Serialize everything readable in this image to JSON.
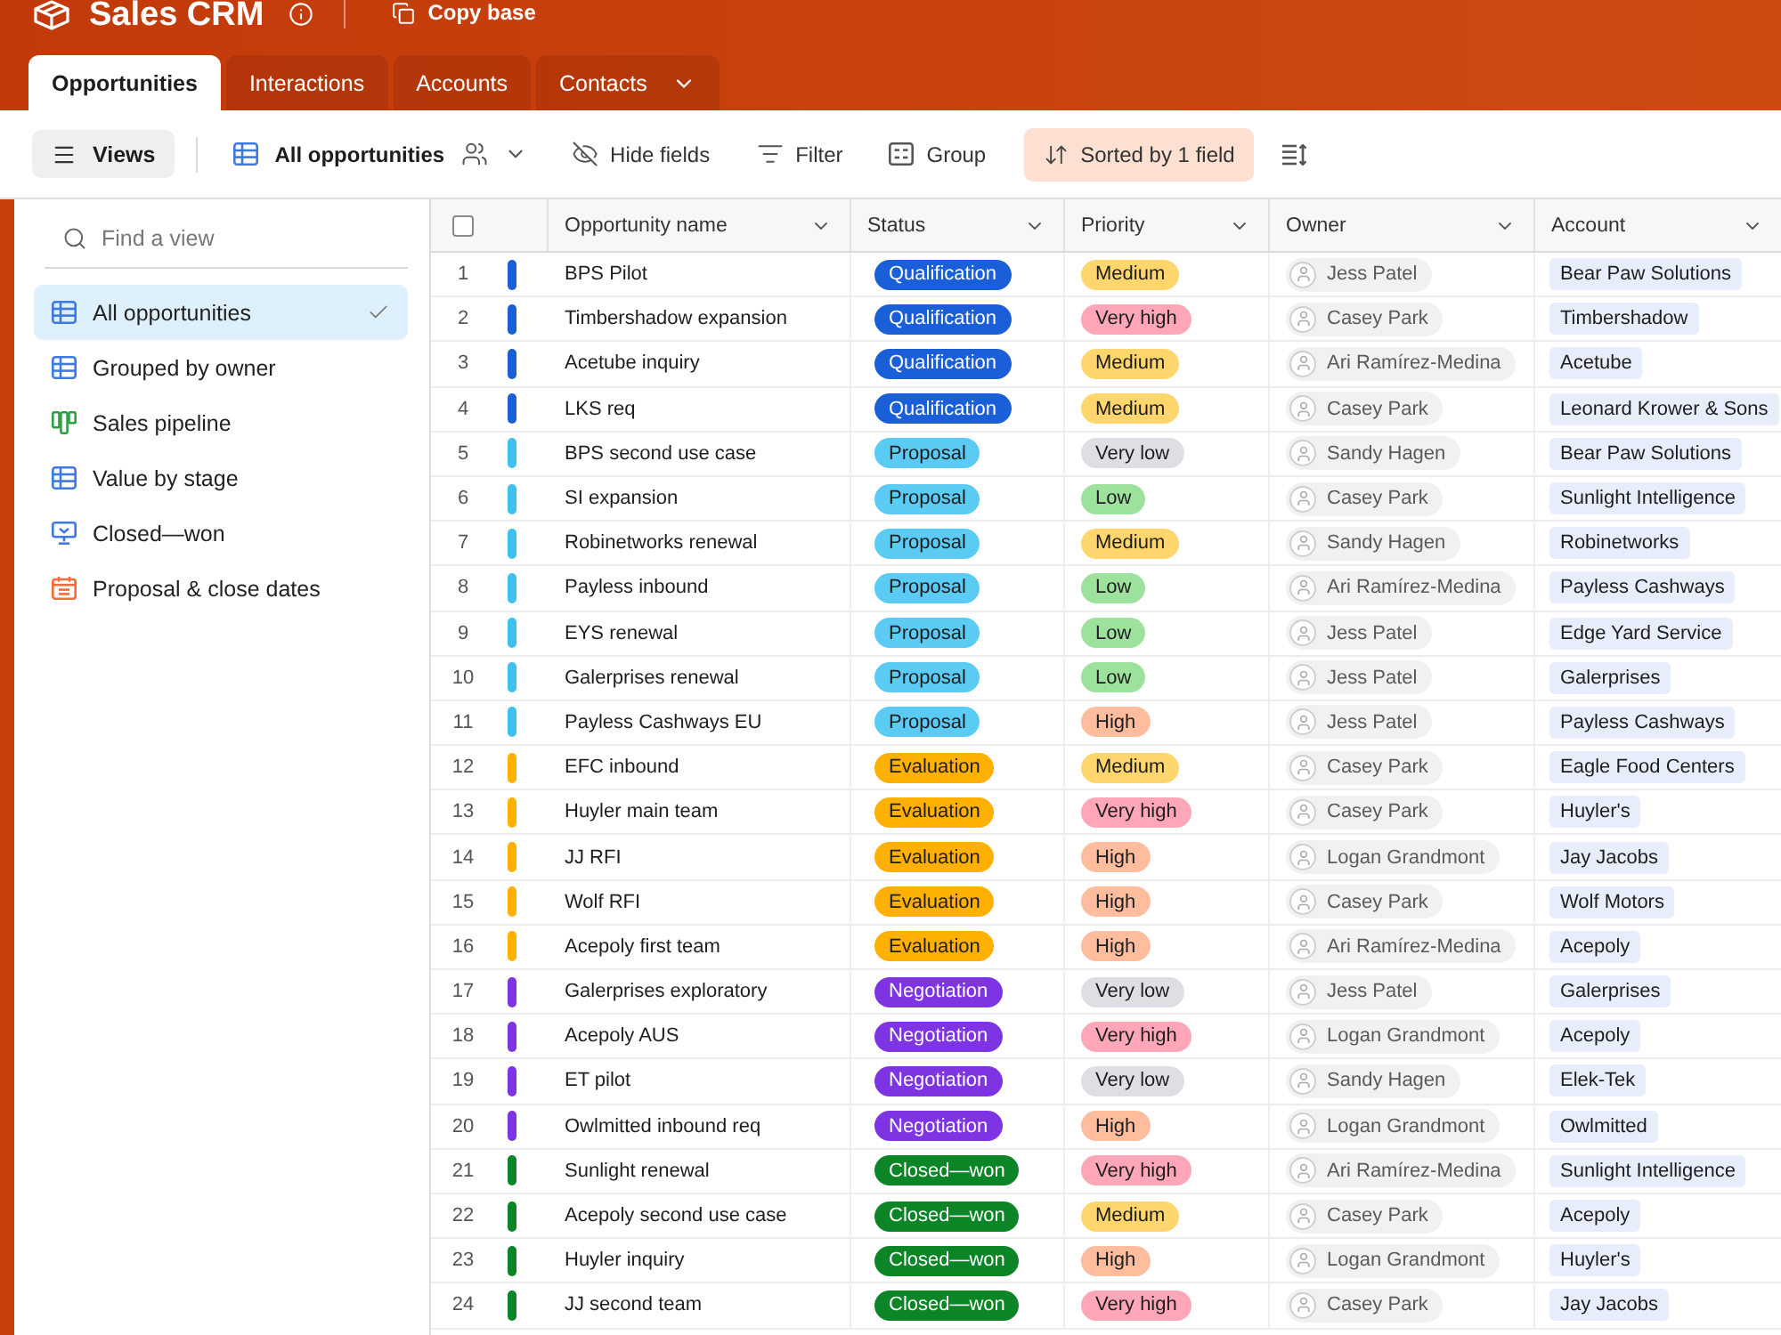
{
  "header": {
    "title": "Sales CRM",
    "copy_button": "Copy base"
  },
  "tabs": [
    {
      "label": "Opportunities",
      "selected": true,
      "dropdown": false
    },
    {
      "label": "Interactions",
      "selected": false,
      "dropdown": false
    },
    {
      "label": "Accounts",
      "selected": false,
      "dropdown": false
    },
    {
      "label": "Contacts",
      "selected": false,
      "dropdown": true
    }
  ],
  "toolbar": {
    "views_button": "Views",
    "current_view": "All opportunities",
    "actions": [
      {
        "kind": "hide",
        "label": "Hide fields",
        "active": false
      },
      {
        "kind": "filter",
        "label": "Filter",
        "active": false
      },
      {
        "kind": "group",
        "label": "Group",
        "active": false
      },
      {
        "kind": "sort",
        "label": "Sorted by 1 field",
        "active": true
      }
    ]
  },
  "sidebar": {
    "search": {
      "placeholder": "Find a view"
    },
    "views": [
      {
        "kind": "grid",
        "label": "All opportunities",
        "selected": true
      },
      {
        "kind": "grid",
        "label": "Grouped by owner",
        "selected": false
      },
      {
        "kind": "kanban",
        "label": "Sales pipeline",
        "selected": false
      },
      {
        "kind": "grid",
        "label": "Value by stage",
        "selected": false
      },
      {
        "kind": "form",
        "label": "Closed—won",
        "selected": false
      },
      {
        "kind": "calendar",
        "label": "Proposal & close dates",
        "selected": false
      }
    ]
  },
  "table": {
    "select_all": {
      "checked": false
    },
    "columns": [
      "Opportunity name",
      "Status",
      "Priority",
      "Owner",
      "Account"
    ],
    "rows": [
      {
        "number": "1",
        "name": "BPS Pilot",
        "color": "#1b5fd8",
        "status": {
          "label": "Qualification",
          "color": "#1b5fd8"
        },
        "priority": {
          "label": "Medium",
          "color": "#ffd66e"
        },
        "owner": "Jess Patel",
        "account": "Bear Paw Solutions"
      },
      {
        "number": "2",
        "name": "Timbershadow expansion",
        "color": "#1b5fd8",
        "status": {
          "label": "Qualification",
          "color": "#1b5fd8"
        },
        "priority": {
          "label": "Very high",
          "color": "#ffa6b8"
        },
        "owner": "Casey Park",
        "account": "Timbershadow"
      },
      {
        "number": "3",
        "name": "Acetube inquiry",
        "color": "#1b5fd8",
        "status": {
          "label": "Qualification",
          "color": "#1b5fd8"
        },
        "priority": {
          "label": "Medium",
          "color": "#ffd66e"
        },
        "owner": "Ari Ramírez-Medina",
        "account": "Acetube"
      },
      {
        "number": "4",
        "name": "LKS req",
        "color": "#1b5fd8",
        "status": {
          "label": "Qualification",
          "color": "#1b5fd8"
        },
        "priority": {
          "label": "Medium",
          "color": "#ffd66e"
        },
        "owner": "Casey Park",
        "account": "Leonard Krower & Sons"
      },
      {
        "number": "5",
        "name": "BPS second use case",
        "color": "#3fc1f0",
        "status": {
          "label": "Proposal",
          "color": "#5ccbf3"
        },
        "priority": {
          "label": "Very low",
          "color": "#dddfe4"
        },
        "owner": "Sandy Hagen",
        "account": "Bear Paw Solutions"
      },
      {
        "number": "6",
        "name": "SI expansion",
        "color": "#3fc1f0",
        "status": {
          "label": "Proposal",
          "color": "#5ccbf3"
        },
        "priority": {
          "label": "Low",
          "color": "#9de29c"
        },
        "owner": "Casey Park",
        "account": "Sunlight Intelligence"
      },
      {
        "number": "7",
        "name": "Robinetworks renewal",
        "color": "#3fc1f0",
        "status": {
          "label": "Proposal",
          "color": "#5ccbf3"
        },
        "priority": {
          "label": "Medium",
          "color": "#ffd66e"
        },
        "owner": "Sandy Hagen",
        "account": "Robinetworks"
      },
      {
        "number": "8",
        "name": "Payless inbound",
        "color": "#3fc1f0",
        "status": {
          "label": "Proposal",
          "color": "#5ccbf3"
        },
        "priority": {
          "label": "Low",
          "color": "#9de29c"
        },
        "owner": "Ari Ramírez-Medina",
        "account": "Payless Cashways"
      },
      {
        "number": "9",
        "name": "EYS renewal",
        "color": "#3fc1f0",
        "status": {
          "label": "Proposal",
          "color": "#5ccbf3"
        },
        "priority": {
          "label": "Low",
          "color": "#9de29c"
        },
        "owner": "Jess Patel",
        "account": "Edge Yard Service"
      },
      {
        "number": "10",
        "name": "Galerprises renewal",
        "color": "#3fc1f0",
        "status": {
          "label": "Proposal",
          "color": "#5ccbf3"
        },
        "priority": {
          "label": "Low",
          "color": "#9de29c"
        },
        "owner": "Jess Patel",
        "account": "Galerprises"
      },
      {
        "number": "11",
        "name": "Payless Cashways EU",
        "color": "#3fc1f0",
        "status": {
          "label": "Proposal",
          "color": "#5ccbf3"
        },
        "priority": {
          "label": "High",
          "color": "#ffbd9e"
        },
        "owner": "Jess Patel",
        "account": "Payless Cashways"
      },
      {
        "number": "12",
        "name": "EFC inbound",
        "color": "#ffb000",
        "status": {
          "label": "Evaluation",
          "color": "#ffb000"
        },
        "priority": {
          "label": "Medium",
          "color": "#ffd66e"
        },
        "owner": "Casey Park",
        "account": "Eagle Food Centers"
      },
      {
        "number": "13",
        "name": "Huyler main team",
        "color": "#ffb000",
        "status": {
          "label": "Evaluation",
          "color": "#ffb000"
        },
        "priority": {
          "label": "Very high",
          "color": "#ffa6b8"
        },
        "owner": "Casey Park",
        "account": "Huyler's"
      },
      {
        "number": "14",
        "name": "JJ RFI",
        "color": "#ffb000",
        "status": {
          "label": "Evaluation",
          "color": "#ffb000"
        },
        "priority": {
          "label": "High",
          "color": "#ffbd9e"
        },
        "owner": "Logan Grandmont",
        "account": "Jay Jacobs"
      },
      {
        "number": "15",
        "name": "Wolf RFI",
        "color": "#ffb000",
        "status": {
          "label": "Evaluation",
          "color": "#ffb000"
        },
        "priority": {
          "label": "High",
          "color": "#ffbd9e"
        },
        "owner": "Casey Park",
        "account": "Wolf Motors"
      },
      {
        "number": "16",
        "name": "Acepoly first team",
        "color": "#ffb000",
        "status": {
          "label": "Evaluation",
          "color": "#ffb000"
        },
        "priority": {
          "label": "High",
          "color": "#ffbd9e"
        },
        "owner": "Ari Ramírez-Medina",
        "account": "Acepoly"
      },
      {
        "number": "17",
        "name": "Galerprises exploratory",
        "color": "#7f34e3",
        "status": {
          "label": "Negotiation",
          "color": "#7f34e3"
        },
        "priority": {
          "label": "Very low",
          "color": "#dddfe4"
        },
        "owner": "Jess Patel",
        "account": "Galerprises"
      },
      {
        "number": "18",
        "name": "Acepoly AUS",
        "color": "#7f34e3",
        "status": {
          "label": "Negotiation",
          "color": "#7f34e3"
        },
        "priority": {
          "label": "Very high",
          "color": "#ffa6b8"
        },
        "owner": "Logan Grandmont",
        "account": "Acepoly"
      },
      {
        "number": "19",
        "name": "ET pilot",
        "color": "#7f34e3",
        "status": {
          "label": "Negotiation",
          "color": "#7f34e3"
        },
        "priority": {
          "label": "Very low",
          "color": "#dddfe4"
        },
        "owner": "Sandy Hagen",
        "account": "Elek-Tek"
      },
      {
        "number": "20",
        "name": "Owlmitted inbound req",
        "color": "#7f34e3",
        "status": {
          "label": "Negotiation",
          "color": "#7f34e3"
        },
        "priority": {
          "label": "High",
          "color": "#ffbd9e"
        },
        "owner": "Logan Grandmont",
        "account": "Owlmitted"
      },
      {
        "number": "21",
        "name": "Sunlight renewal",
        "color": "#0b8525",
        "status": {
          "label": "Closed—won",
          "color": "#0b8525"
        },
        "priority": {
          "label": "Very high",
          "color": "#ffa6b8"
        },
        "owner": "Ari Ramírez-Medina",
        "account": "Sunlight Intelligence"
      },
      {
        "number": "22",
        "name": "Acepoly second use case",
        "color": "#0b8525",
        "status": {
          "label": "Closed—won",
          "color": "#0b8525"
        },
        "priority": {
          "label": "Medium",
          "color": "#ffd66e"
        },
        "owner": "Casey Park",
        "account": "Acepoly"
      },
      {
        "number": "23",
        "name": "Huyler inquiry",
        "color": "#0b8525",
        "status": {
          "label": "Closed—won",
          "color": "#0b8525"
        },
        "priority": {
          "label": "High",
          "color": "#ffbd9e"
        },
        "owner": "Logan Grandmont",
        "account": "Huyler's"
      },
      {
        "number": "24",
        "name": "JJ second team",
        "color": "#0b8525",
        "status": {
          "label": "Closed—won",
          "color": "#0b8525"
        },
        "priority": {
          "label": "Very high",
          "color": "#ffa6b8"
        },
        "owner": "Casey Park",
        "account": "Jay Jacobs"
      }
    ]
  }
}
